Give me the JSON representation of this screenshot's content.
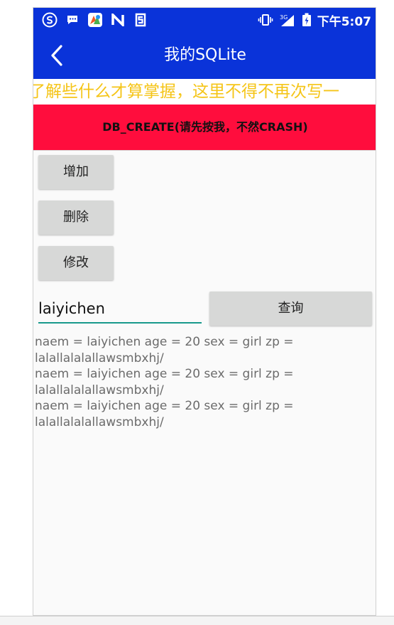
{
  "status_bar": {
    "time": "下午5:07",
    "network": "3G",
    "icons_left": [
      "s-logo-icon",
      "message-icon",
      "app-color-icon",
      "n-icon",
      "s5-icon"
    ],
    "icons_right": [
      "vibrate-icon",
      "signal-icon",
      "battery-icon"
    ]
  },
  "toolbar": {
    "title": "我的SQLite",
    "back_icon": "back-chevron-icon",
    "color": "#0a33d9"
  },
  "marquee": {
    "text": "了解些什么才算掌握，这里不得不再次写一",
    "color": "#f5c518"
  },
  "db_create": {
    "label": "DB_CREATE(请先按我，不然CRASH)",
    "color": "#ff0d3d"
  },
  "buttons": {
    "add": "增加",
    "delete": "删除",
    "modify": "修改",
    "query": "查询"
  },
  "search": {
    "value": "laiyichen",
    "underline_color": "#189a8c"
  },
  "results": [
    "naem = laiyichen  age = 20  sex = girl zp =",
    "lalallalalallawsmbxhj/",
    "naem = laiyichen  age = 20  sex = girl zp =",
    "lalallalalallawsmbxhj/",
    "naem = laiyichen  age = 20  sex = girl zp =",
    "lalallalalallawsmbxhj/"
  ]
}
